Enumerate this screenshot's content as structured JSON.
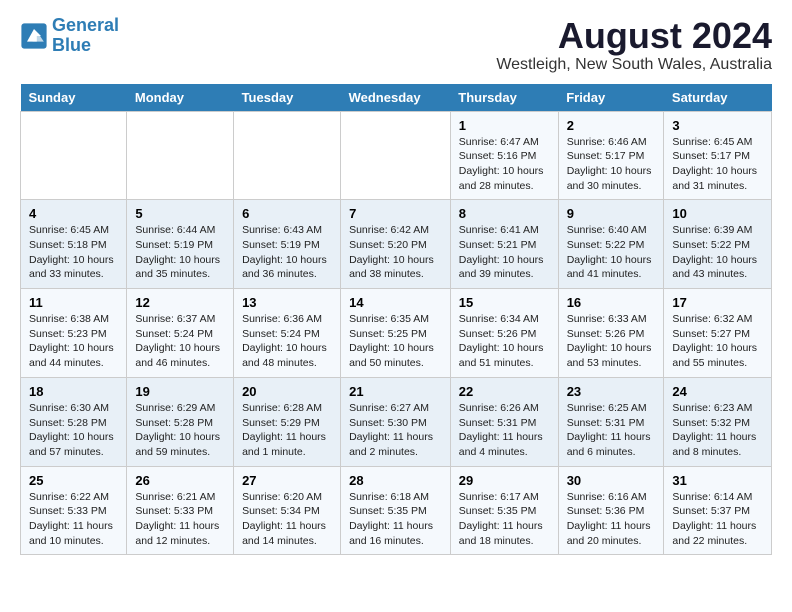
{
  "logo": {
    "line1": "General",
    "line2": "Blue"
  },
  "title": "August 2024",
  "subtitle": "Westleigh, New South Wales, Australia",
  "days_of_week": [
    "Sunday",
    "Monday",
    "Tuesday",
    "Wednesday",
    "Thursday",
    "Friday",
    "Saturday"
  ],
  "weeks": [
    [
      {
        "num": "",
        "detail": ""
      },
      {
        "num": "",
        "detail": ""
      },
      {
        "num": "",
        "detail": ""
      },
      {
        "num": "",
        "detail": ""
      },
      {
        "num": "1",
        "detail": "Sunrise: 6:47 AM\nSunset: 5:16 PM\nDaylight: 10 hours\nand 28 minutes."
      },
      {
        "num": "2",
        "detail": "Sunrise: 6:46 AM\nSunset: 5:17 PM\nDaylight: 10 hours\nand 30 minutes."
      },
      {
        "num": "3",
        "detail": "Sunrise: 6:45 AM\nSunset: 5:17 PM\nDaylight: 10 hours\nand 31 minutes."
      }
    ],
    [
      {
        "num": "4",
        "detail": "Sunrise: 6:45 AM\nSunset: 5:18 PM\nDaylight: 10 hours\nand 33 minutes."
      },
      {
        "num": "5",
        "detail": "Sunrise: 6:44 AM\nSunset: 5:19 PM\nDaylight: 10 hours\nand 35 minutes."
      },
      {
        "num": "6",
        "detail": "Sunrise: 6:43 AM\nSunset: 5:19 PM\nDaylight: 10 hours\nand 36 minutes."
      },
      {
        "num": "7",
        "detail": "Sunrise: 6:42 AM\nSunset: 5:20 PM\nDaylight: 10 hours\nand 38 minutes."
      },
      {
        "num": "8",
        "detail": "Sunrise: 6:41 AM\nSunset: 5:21 PM\nDaylight: 10 hours\nand 39 minutes."
      },
      {
        "num": "9",
        "detail": "Sunrise: 6:40 AM\nSunset: 5:22 PM\nDaylight: 10 hours\nand 41 minutes."
      },
      {
        "num": "10",
        "detail": "Sunrise: 6:39 AM\nSunset: 5:22 PM\nDaylight: 10 hours\nand 43 minutes."
      }
    ],
    [
      {
        "num": "11",
        "detail": "Sunrise: 6:38 AM\nSunset: 5:23 PM\nDaylight: 10 hours\nand 44 minutes."
      },
      {
        "num": "12",
        "detail": "Sunrise: 6:37 AM\nSunset: 5:24 PM\nDaylight: 10 hours\nand 46 minutes."
      },
      {
        "num": "13",
        "detail": "Sunrise: 6:36 AM\nSunset: 5:24 PM\nDaylight: 10 hours\nand 48 minutes."
      },
      {
        "num": "14",
        "detail": "Sunrise: 6:35 AM\nSunset: 5:25 PM\nDaylight: 10 hours\nand 50 minutes."
      },
      {
        "num": "15",
        "detail": "Sunrise: 6:34 AM\nSunset: 5:26 PM\nDaylight: 10 hours\nand 51 minutes."
      },
      {
        "num": "16",
        "detail": "Sunrise: 6:33 AM\nSunset: 5:26 PM\nDaylight: 10 hours\nand 53 minutes."
      },
      {
        "num": "17",
        "detail": "Sunrise: 6:32 AM\nSunset: 5:27 PM\nDaylight: 10 hours\nand 55 minutes."
      }
    ],
    [
      {
        "num": "18",
        "detail": "Sunrise: 6:30 AM\nSunset: 5:28 PM\nDaylight: 10 hours\nand 57 minutes."
      },
      {
        "num": "19",
        "detail": "Sunrise: 6:29 AM\nSunset: 5:28 PM\nDaylight: 10 hours\nand 59 minutes."
      },
      {
        "num": "20",
        "detail": "Sunrise: 6:28 AM\nSunset: 5:29 PM\nDaylight: 11 hours\nand 1 minute."
      },
      {
        "num": "21",
        "detail": "Sunrise: 6:27 AM\nSunset: 5:30 PM\nDaylight: 11 hours\nand 2 minutes."
      },
      {
        "num": "22",
        "detail": "Sunrise: 6:26 AM\nSunset: 5:31 PM\nDaylight: 11 hours\nand 4 minutes."
      },
      {
        "num": "23",
        "detail": "Sunrise: 6:25 AM\nSunset: 5:31 PM\nDaylight: 11 hours\nand 6 minutes."
      },
      {
        "num": "24",
        "detail": "Sunrise: 6:23 AM\nSunset: 5:32 PM\nDaylight: 11 hours\nand 8 minutes."
      }
    ],
    [
      {
        "num": "25",
        "detail": "Sunrise: 6:22 AM\nSunset: 5:33 PM\nDaylight: 11 hours\nand 10 minutes."
      },
      {
        "num": "26",
        "detail": "Sunrise: 6:21 AM\nSunset: 5:33 PM\nDaylight: 11 hours\nand 12 minutes."
      },
      {
        "num": "27",
        "detail": "Sunrise: 6:20 AM\nSunset: 5:34 PM\nDaylight: 11 hours\nand 14 minutes."
      },
      {
        "num": "28",
        "detail": "Sunrise: 6:18 AM\nSunset: 5:35 PM\nDaylight: 11 hours\nand 16 minutes."
      },
      {
        "num": "29",
        "detail": "Sunrise: 6:17 AM\nSunset: 5:35 PM\nDaylight: 11 hours\nand 18 minutes."
      },
      {
        "num": "30",
        "detail": "Sunrise: 6:16 AM\nSunset: 5:36 PM\nDaylight: 11 hours\nand 20 minutes."
      },
      {
        "num": "31",
        "detail": "Sunrise: 6:14 AM\nSunset: 5:37 PM\nDaylight: 11 hours\nand 22 minutes."
      }
    ]
  ]
}
